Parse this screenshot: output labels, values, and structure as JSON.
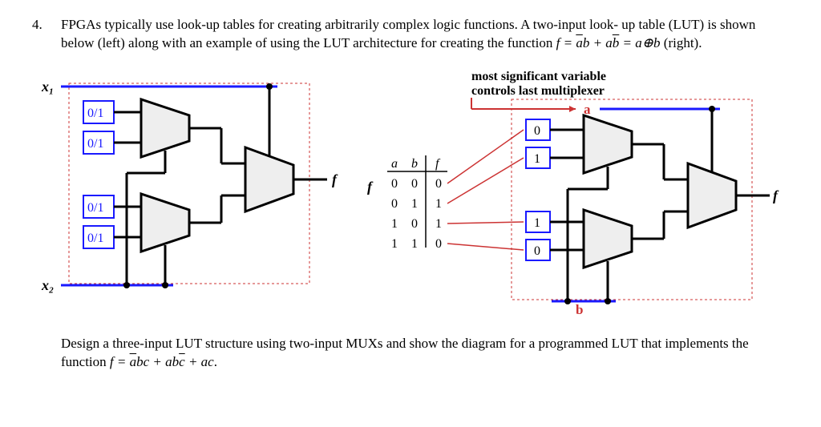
{
  "problem_number": "4.",
  "intro_line1": "FPGAs typically use look-up tables for creating arbitrarily complex logic functions. A two-input look-",
  "intro_line2": "up table (LUT) is shown below (left) along with an example of using the LUT architecture for creating",
  "intro_line3_prefix": "the function ",
  "intro_line3_suffix": " (right).",
  "left_diagram": {
    "x1_label": "x₁",
    "x2_label": "x₂",
    "cell_labels": [
      "0/1",
      "0/1",
      "0/1",
      "0/1"
    ],
    "output_label": "f"
  },
  "right_diagram": {
    "header_line1": "most significant variable",
    "header_line2": "controls last multiplexer",
    "a_label": "a",
    "b_label": "b",
    "output_label": "f",
    "truth_table": {
      "col_a": "a",
      "col_b": "b",
      "col_f": "f",
      "label_f": "f",
      "rows": [
        {
          "a": "0",
          "b": "0",
          "f": "0"
        },
        {
          "a": "0",
          "b": "1",
          "f": "1"
        },
        {
          "a": "1",
          "b": "0",
          "f": "1"
        },
        {
          "a": "1",
          "b": "1",
          "f": "0"
        }
      ]
    },
    "cell_values": [
      "0",
      "1",
      "1",
      "0"
    ]
  },
  "design_line1": "Design a three-input LUT structure using two-input MUXs and show the diagram for a programmed",
  "design_line2_prefix": "LUT that implements the function ",
  "design_line2_suffix": "."
}
